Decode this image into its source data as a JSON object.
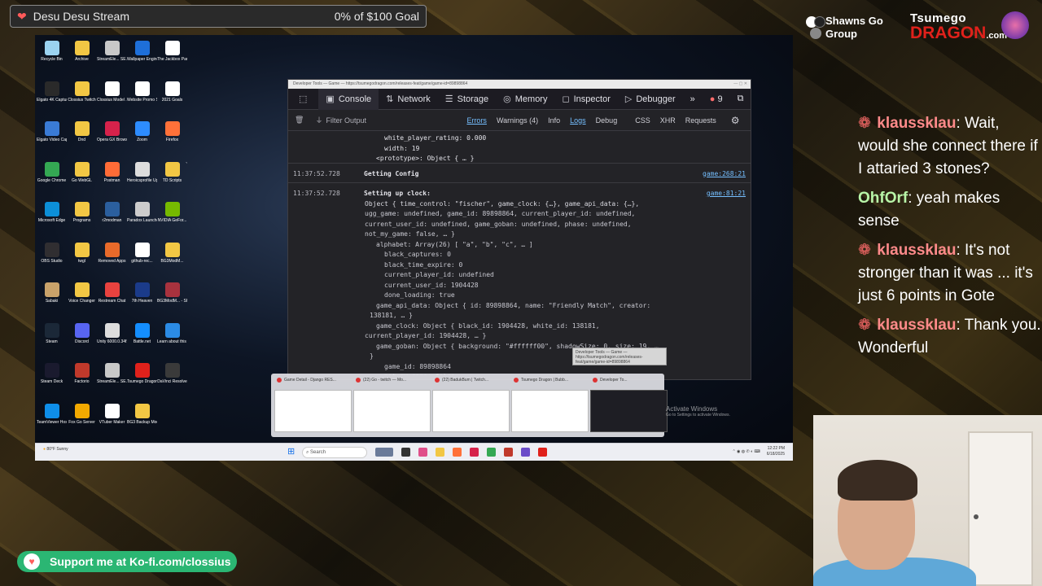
{
  "goal": {
    "title": "Desu Desu Stream",
    "progress_text": "0% of $100 Goal",
    "progress": 0
  },
  "desktop_icons": [
    {
      "label": "Recycle Bin",
      "color": "#9bd3f0"
    },
    {
      "label": "Archive",
      "color": "#f2c744"
    },
    {
      "label": "StreamEle... SE.Live",
      "color": "#c8c8c8"
    },
    {
      "label": "Wallpaper Engine",
      "color": "#1e6fd9"
    },
    {
      "label": "The Jackbox Party Pack 3",
      "color": "#ffffff"
    },
    {
      "label": "Elgato 4K Captur...",
      "color": "#2a2a2a"
    },
    {
      "label": "Clossius Twitch",
      "color": "#f2c744"
    },
    {
      "label": "Clossius Model ...",
      "color": "#ffffff"
    },
    {
      "label": "Website Promo Script",
      "color": "#ffffff"
    },
    {
      "label": "2021 Goals",
      "color": "#ffffff"
    },
    {
      "label": "Elgato Video Capture",
      "color": "#3a7bd5"
    },
    {
      "label": "Dnd",
      "color": "#f2c744"
    },
    {
      "label": "Opera GX Browser",
      "color": "#d6224b"
    },
    {
      "label": "Zoom",
      "color": "#2d8cff"
    },
    {
      "label": "Firefox",
      "color": "#ff7139"
    },
    {
      "label": "Google Chrome",
      "color": "#34a853"
    },
    {
      "label": "Go WebGL",
      "color": "#f2c744"
    },
    {
      "label": "Postman",
      "color": "#ff6c37"
    },
    {
      "label": "Heroicsprofile Uploader",
      "color": "#dddddd"
    },
    {
      "label": "TD Scripts",
      "color": "#f2c744"
    },
    {
      "label": "Microsoft Edge",
      "color": "#0c8fd8"
    },
    {
      "label": "Programs",
      "color": "#f2c744"
    },
    {
      "label": "r2modman",
      "color": "#2b5f9e"
    },
    {
      "label": "Paradox Launcher v2",
      "color": "#cccccc"
    },
    {
      "label": "NVIDIA GeFor...",
      "color": "#76b900"
    },
    {
      "label": "OBS Studio",
      "color": "#302e31"
    },
    {
      "label": "twgl",
      "color": "#f2c744"
    },
    {
      "label": "Removed Apps",
      "color": "#e86a2a"
    },
    {
      "label": "github-rec...",
      "color": "#ffffff"
    },
    {
      "label": "BG3ModM...",
      "color": "#f2c744"
    },
    {
      "label": "Sabaki",
      "color": "#c9a26a"
    },
    {
      "label": "Voice Changer",
      "color": "#f2c744"
    },
    {
      "label": "Restream Chat",
      "color": "#e8423f"
    },
    {
      "label": "7th Heaven",
      "color": "#1b3b8a"
    },
    {
      "label": "BG3ModM... - Shortcut",
      "color": "#a8323e"
    },
    {
      "label": "Steam",
      "color": "#1b2838"
    },
    {
      "label": "Discord",
      "color": "#5865f2"
    },
    {
      "label": "Unity 6000.0.34f1",
      "color": "#dddddd"
    },
    {
      "label": "Battle.net",
      "color": "#148eff"
    },
    {
      "label": "Learn about this picture",
      "color": "#2b8be5"
    },
    {
      "label": "Steam Deck",
      "color": "#1a1a2e"
    },
    {
      "label": "Factorio",
      "color": "#c0392b"
    },
    {
      "label": "StreamEle... SE.Live",
      "color": "#c8c8c8"
    },
    {
      "label": "Tsumego Dragon",
      "color": "#e0211b"
    },
    {
      "label": "DaVinci Resolve",
      "color": "#3a3a3a"
    },
    {
      "label": "TeamViewer Host",
      "color": "#0e8ee9"
    },
    {
      "label": "Fox Go Server",
      "color": "#f2a900"
    },
    {
      "label": "VTuber Maker",
      "color": "#ffffff"
    },
    {
      "label": "BG3 Backup Mods",
      "color": "#f2c744"
    }
  ],
  "devtools": {
    "window_title": "Developer Tools — Game — https://tsumegodragon.com/releases-feat/game/game-id=89898864",
    "tabs": [
      {
        "label": "Console",
        "icon": "console-icon"
      },
      {
        "label": "Network",
        "icon": "network-icon"
      },
      {
        "label": "Storage",
        "icon": "storage-icon"
      },
      {
        "label": "Memory",
        "icon": "memory-icon"
      },
      {
        "label": "Inspector",
        "icon": "inspector-icon"
      },
      {
        "label": "Debugger",
        "icon": "debugger-icon"
      }
    ],
    "error_count": "9",
    "filter_placeholder": "Filter Output",
    "levels": [
      "Errors",
      "Warnings (4)",
      "Info",
      "Logs",
      "Debug",
      "CSS",
      "XHR",
      "Requests"
    ],
    "console_lines": [
      {
        "text": "white_player_rating: 0.000"
      },
      {
        "text": "width: 19"
      },
      {
        "text": "<prototype>: Object { … }"
      },
      {
        "ts": "11:37:52.728",
        "text": "Getting Config",
        "src": "game:268:21"
      },
      {
        "ts": "11:37:52.728",
        "text": "Setting up clock:",
        "src": "game:81:21"
      },
      {
        "text": "Object { time_control: \"fischer\", game_clock: {…}, game_api_data: {…},"
      },
      {
        "text": "ugg_game: undefined, game_id: 89898864, current_player_id: undefined,"
      },
      {
        "text": "current_user_id: undefined, game_goban: undefined, phase: undefined,"
      },
      {
        "text": "not_my_game: false, … }"
      },
      {
        "text": "alphabet: Array(26) [ \"a\", \"b\", \"c\", … ]"
      },
      {
        "text": "black_captures: 0"
      },
      {
        "text": "black_time_expire: 0"
      },
      {
        "text": "current_player_id: undefined"
      },
      {
        "text": "current_user_id: 1904428"
      },
      {
        "text": "done_loading: true"
      },
      {
        "text": "game_api_data: Object { id: 89898864, name: \"Friendly Match\", creator:"
      },
      {
        "text": "138181, … }"
      },
      {
        "text": "game_clock: Object { black_id: 1904428, white_id: 138181,"
      },
      {
        "text": "current_player_id: 1904428, … }"
      },
      {
        "text": "game_goban: Object { background: \"#ffffff00\", shadowSize: 0, size: 19, …"
      },
      {
        "text": "}"
      },
      {
        "text": "game_id: 89898864"
      },
      {
        "text": "not_my_game: false"
      }
    ]
  },
  "taskbar_thumbnails": [
    {
      "label": "Game Detail - Django RES..."
    },
    {
      "label": "(22) Go - twitch — Mo..."
    },
    {
      "label": "(22) BadukBum | Twitch..."
    },
    {
      "label": "Tsumego Dragon | Bubb..."
    },
    {
      "label": "Developer To..."
    }
  ],
  "activate_windows": {
    "title": "Activate Windows",
    "sub": "Go to Settings to activate Windows."
  },
  "taskbar": {
    "weather": "80°F Sunny",
    "search_placeholder": "Search",
    "time": "12:22 PM",
    "date": "6/18/2025"
  },
  "brand": {
    "shawns": "Shawns Go Group",
    "tsumego_line1": "Tsumego",
    "tsumego_line2": "DRAGON",
    "tsumego_com": ".com"
  },
  "chat": [
    {
      "user": "klausskIau",
      "text": "Wait, would she connect there if I attaried 3 stones?",
      "user_color": "#ff8a8a",
      "badge": true
    },
    {
      "user": "OhfOrf",
      "text": "yeah makes sense",
      "user_color": "#b8f5a8",
      "badge": false
    },
    {
      "user": "klausskIau",
      "text": "It's not stronger than it was ... it's just 6 points in Gote",
      "user_color": "#ff8a8a",
      "badge": true
    },
    {
      "user": "klausskIau",
      "text": "Thank you. Wonderful",
      "user_color": "#ff8a8a",
      "badge": true
    }
  ],
  "kofi": {
    "label": "Support me at Ko-fi.com/clossius"
  }
}
